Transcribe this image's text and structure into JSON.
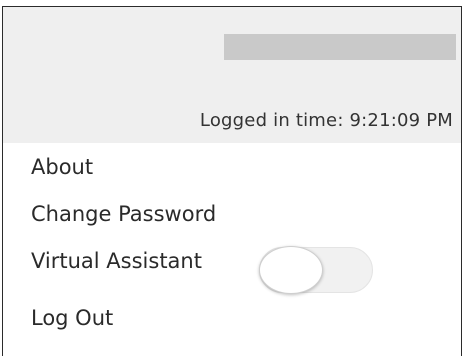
{
  "header": {
    "logged_in_text": "Logged in time: 9:21:09 PM"
  },
  "menu": {
    "items": [
      {
        "label": "About"
      },
      {
        "label": "Change Password"
      },
      {
        "label": "Virtual Assistant"
      },
      {
        "label": "Log Out"
      }
    ]
  },
  "toggle": {
    "virtual_assistant_on": false
  },
  "colors": {
    "header_bg": "#efefef",
    "redaction": "#c9c9c9",
    "text": "#2a2a2a",
    "border": "#2b2b2b"
  }
}
